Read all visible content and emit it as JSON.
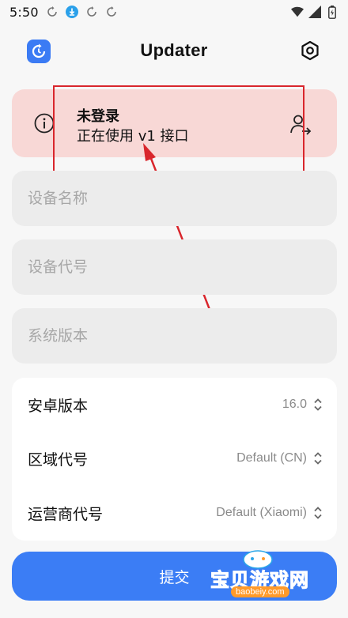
{
  "status_bar": {
    "time": "5:50",
    "icons": [
      "sync-icon",
      "download-icon",
      "sync-icon",
      "sync-icon",
      "wifi-icon",
      "signal-icon",
      "battery-icon"
    ]
  },
  "app_bar": {
    "title": "Updater",
    "icon": "app-logo-icon",
    "settings_icon": "gear-icon"
  },
  "login_card": {
    "title": "未登录",
    "subtitle": "正在使用 v1 接口",
    "info_icon": "info-icon",
    "action_icon": "login-icon",
    "background": "#f8d8d6"
  },
  "fields": {
    "device_name": {
      "placeholder": "设备名称",
      "value": ""
    },
    "device_code": {
      "placeholder": "设备代号",
      "value": ""
    },
    "system_version": {
      "placeholder": "系统版本",
      "value": ""
    }
  },
  "options": [
    {
      "label": "安卓版本",
      "value": "16.0"
    },
    {
      "label": "区域代号",
      "value": "Default (CN)"
    },
    {
      "label": "运营商代号",
      "value": "Default (Xiaomi)"
    }
  ],
  "submit": {
    "label": "提交"
  },
  "watermark": {
    "text": "宝贝游戏网",
    "url": "baobeiy.com"
  },
  "colors": {
    "accent": "#3b7df5",
    "highlight": "#d9262c",
    "error_bg": "#f8d8d6"
  }
}
